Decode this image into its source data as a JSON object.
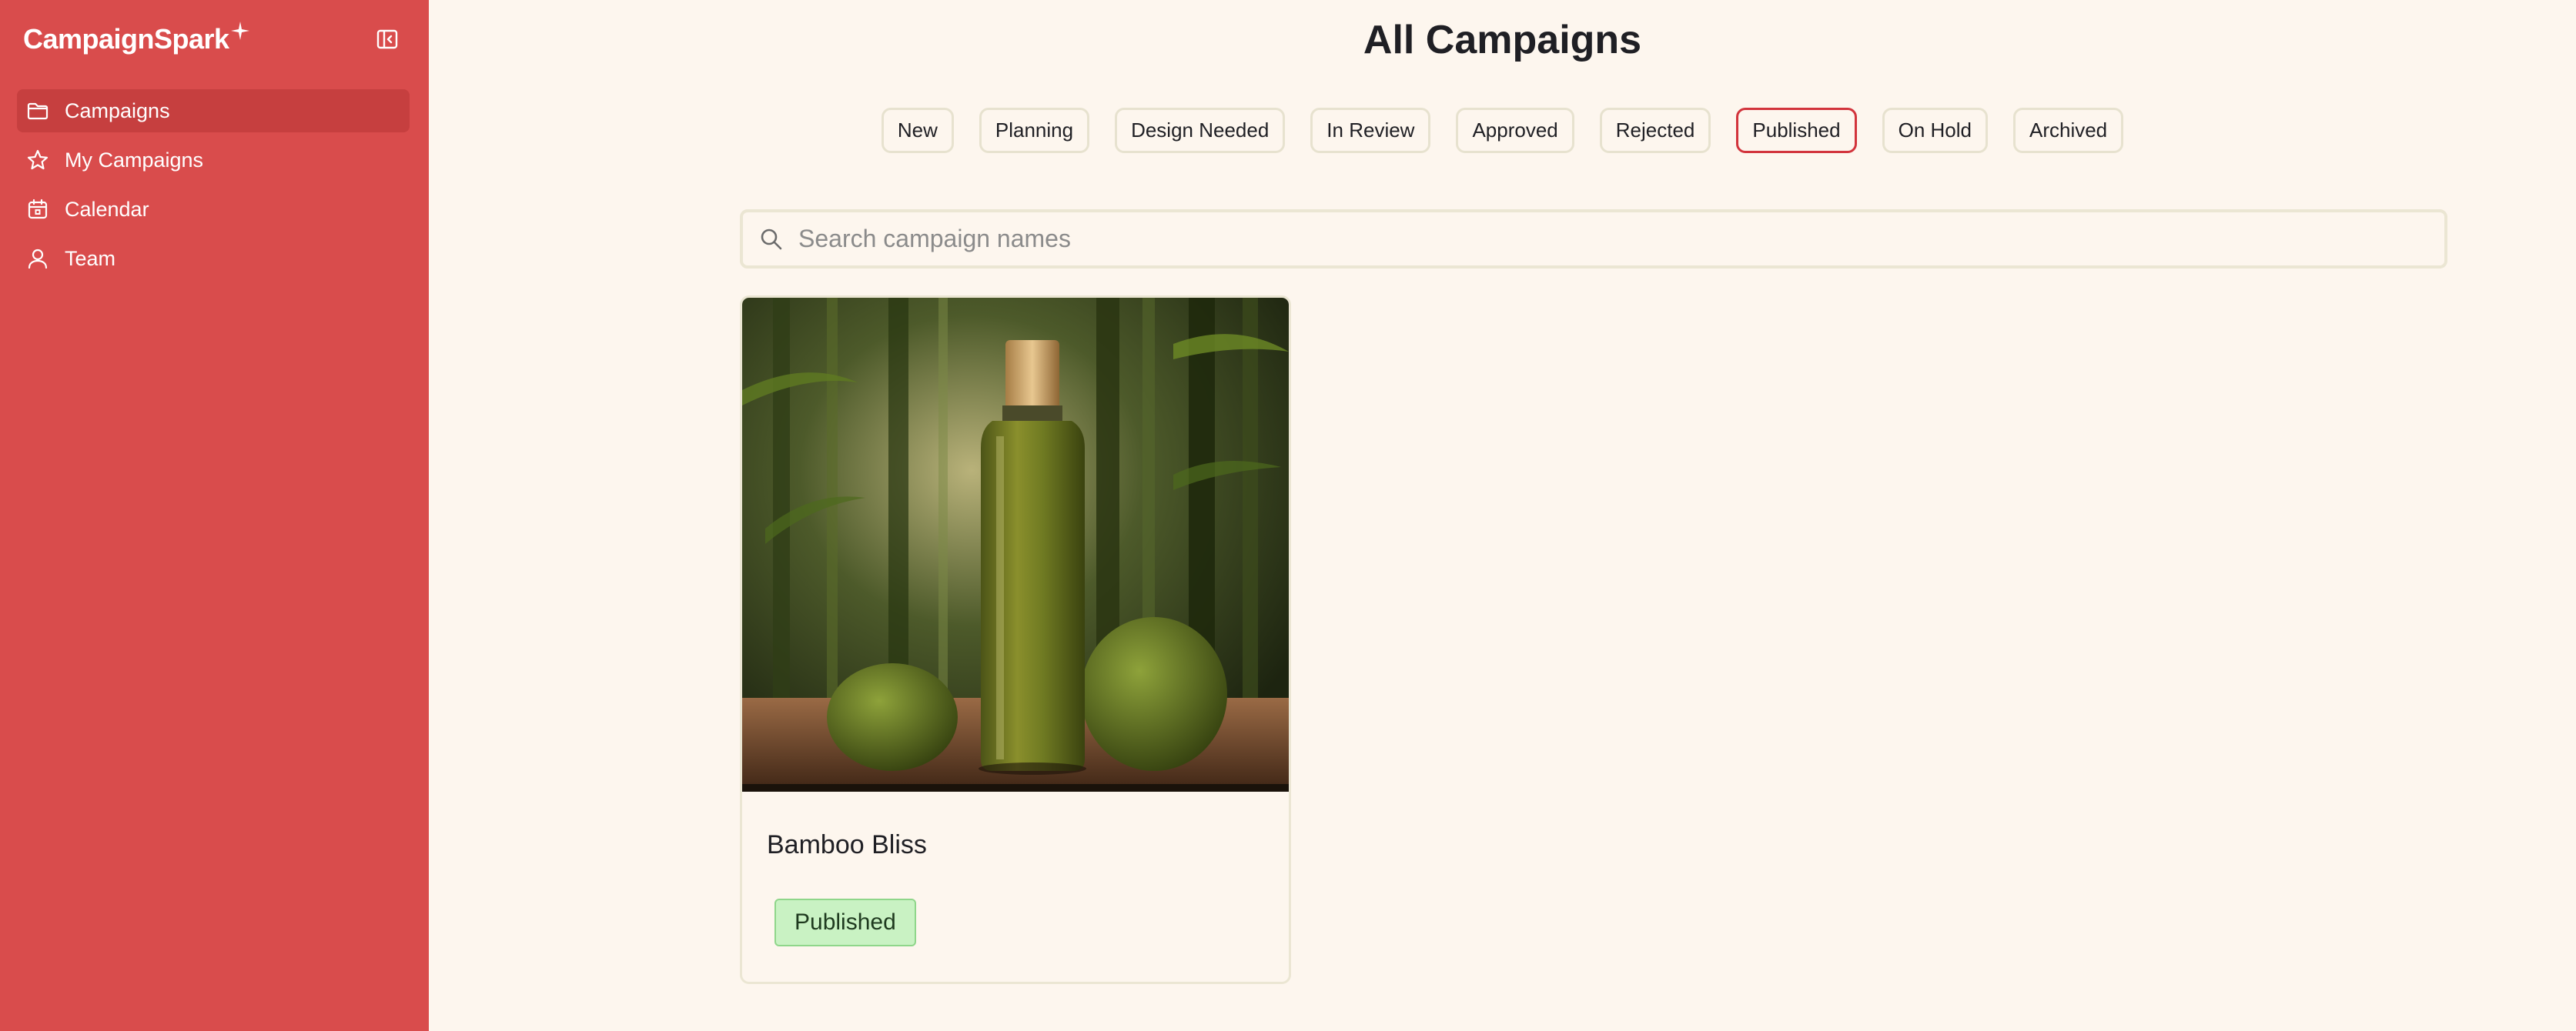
{
  "app": {
    "name": "CampaignSpark",
    "accent": "#d94c4c"
  },
  "sidebar": {
    "items": [
      {
        "label": "Campaigns",
        "icon": "folder-icon",
        "active": true
      },
      {
        "label": "My Campaigns",
        "icon": "star-icon",
        "active": false
      },
      {
        "label": "Calendar",
        "icon": "calendar-icon",
        "active": false
      },
      {
        "label": "Team",
        "icon": "user-icon",
        "active": false
      }
    ]
  },
  "main": {
    "title": "All Campaigns",
    "filters": [
      {
        "label": "New",
        "active": false
      },
      {
        "label": "Planning",
        "active": false
      },
      {
        "label": "Design Needed",
        "active": false
      },
      {
        "label": "In Review",
        "active": false
      },
      {
        "label": "Approved",
        "active": false
      },
      {
        "label": "Rejected",
        "active": false
      },
      {
        "label": "Published",
        "active": true
      },
      {
        "label": "On Hold",
        "active": false
      },
      {
        "label": "Archived",
        "active": false
      }
    ],
    "search": {
      "placeholder": "Search campaign names",
      "value": ""
    },
    "campaigns": [
      {
        "title": "Bamboo Bliss",
        "status": "Published",
        "status_color": "#c9f2c3"
      }
    ]
  }
}
